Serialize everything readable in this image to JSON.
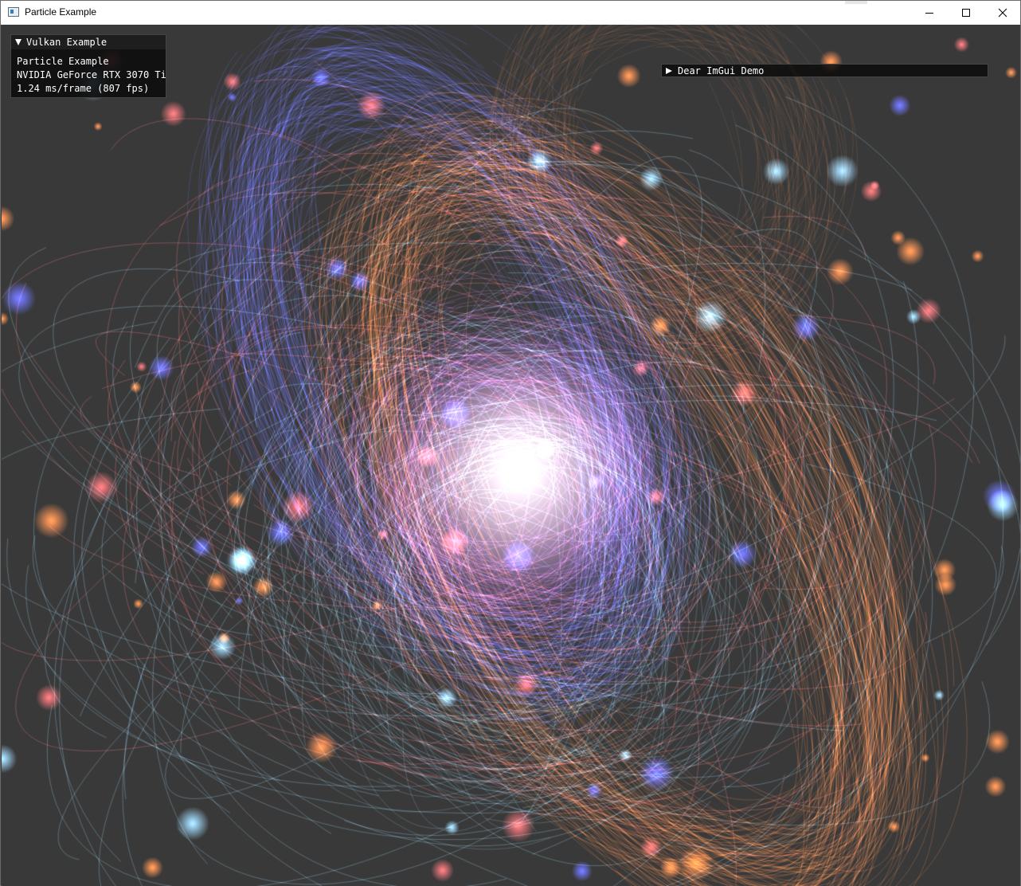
{
  "window": {
    "title": "Particle Example",
    "icon": "app-window-icon"
  },
  "overlay": {
    "panel_title": "Vulkan Example",
    "app_name": "Particle Example",
    "gpu": "NVIDIA GeForce RTX 3070 Ti",
    "frame_stats": "1.24 ms/frame (807 fps)"
  },
  "demo_window": {
    "title": "Dear ImGui Demo"
  },
  "colors": {
    "background": "#393939",
    "particle_blue": "#4a52ff",
    "particle_orange": "#ff7a2a",
    "particle_red": "#f2555a",
    "particle_cyan": "#8ad4ff",
    "core_white": "#ffffff"
  }
}
